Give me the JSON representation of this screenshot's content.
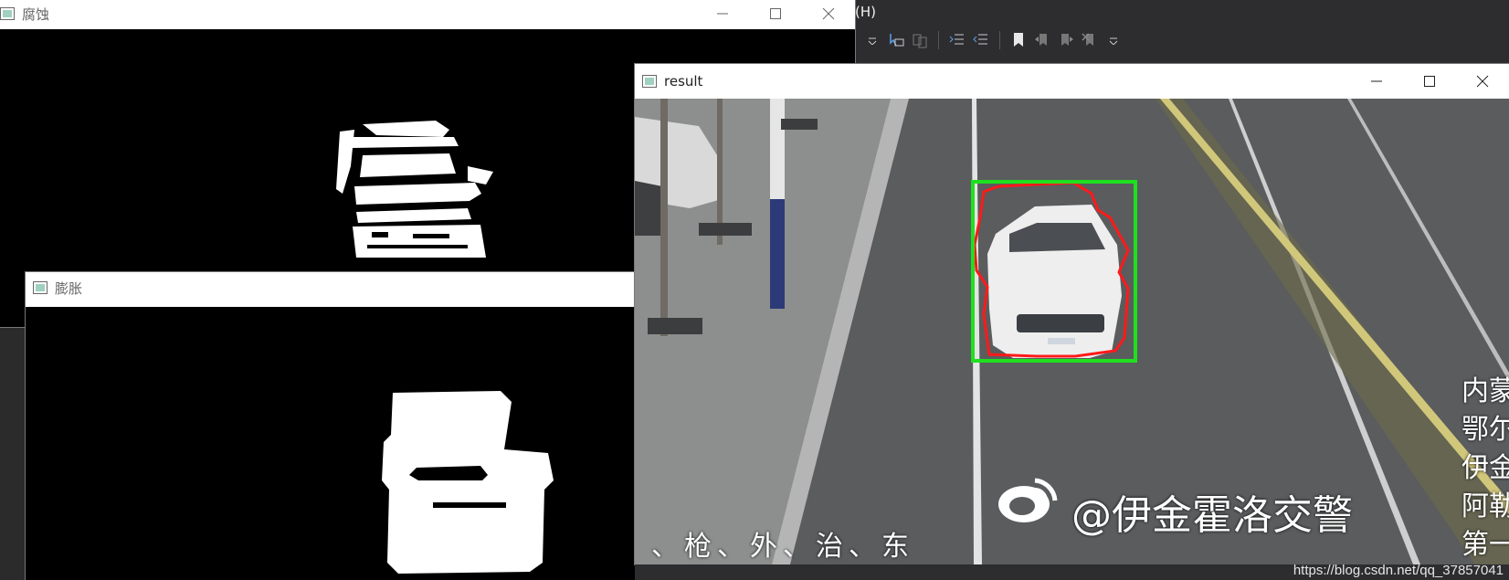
{
  "ide": {
    "menu_tail": "(H)"
  },
  "windows": {
    "erode": {
      "title": "腐蚀"
    },
    "dilate": {
      "title": "膨胀"
    },
    "result": {
      "title": "result"
    }
  },
  "video": {
    "watermark": "@伊金霍洛交警",
    "caption": "、枪、外、治、东",
    "side_text": [
      "内蒙",
      "鄂尔",
      "伊金",
      "阿勒",
      "第一"
    ],
    "detection_box_color": "#1fe01f",
    "contour_color": "#ff1a1a"
  },
  "footer": {
    "url": "https://blog.csdn.net/qq_37857041"
  },
  "icons": {
    "window_app_icon": "app-window-icon",
    "minimize": "minimize-icon",
    "maximize": "maximize-icon",
    "close": "close-icon"
  }
}
